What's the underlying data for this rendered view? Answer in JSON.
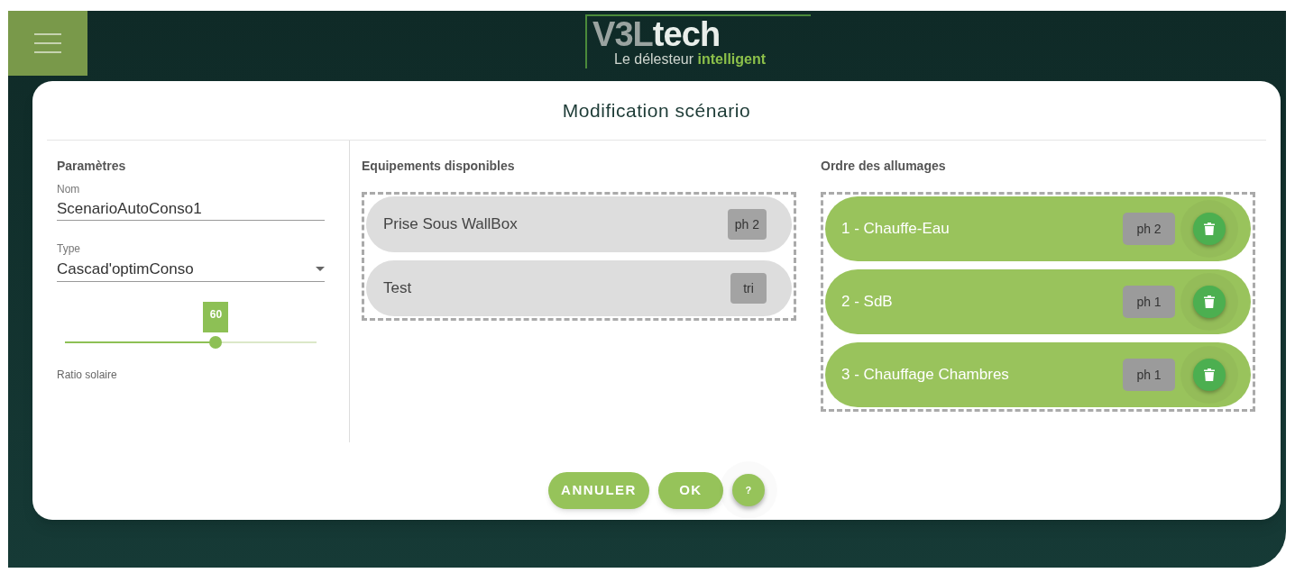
{
  "header": {
    "logo": {
      "part_1": "V3L",
      "part_2": "tech",
      "tagline_1": "Le délesteur ",
      "tagline_2": "intelligent"
    }
  },
  "dialog": {
    "title": "Modification scénario",
    "parameters": {
      "heading": "Paramètres",
      "name_field": {
        "label": "Nom",
        "value": "ScenarioAutoConso1"
      },
      "type_field": {
        "label": "Type",
        "value": "Cascad'optimConso"
      },
      "slider": {
        "level": 0.6,
        "reading": "60",
        "label": "Ratio solaire"
      }
    },
    "available": {
      "heading": "Equipements disponibles",
      "items": [
        {
          "label": "Prise Sous WallBox",
          "phase": "ph 2"
        },
        {
          "label": "Test",
          "phase": "tri"
        }
      ]
    },
    "order": {
      "heading": "Ordre des allumages",
      "items": [
        {
          "label": "1 - Chauffe-Eau",
          "phase": "ph 2"
        },
        {
          "label": "2 - SdB",
          "phase": "ph 1"
        },
        {
          "label": "3 - Chauffage Chambres",
          "phase": "ph 1"
        }
      ]
    },
    "buttons": [
      {
        "kind": "text",
        "label": "ANNULER"
      },
      {
        "kind": "text",
        "label": "OK"
      },
      {
        "kind": "round",
        "label": "?"
      }
    ]
  }
}
